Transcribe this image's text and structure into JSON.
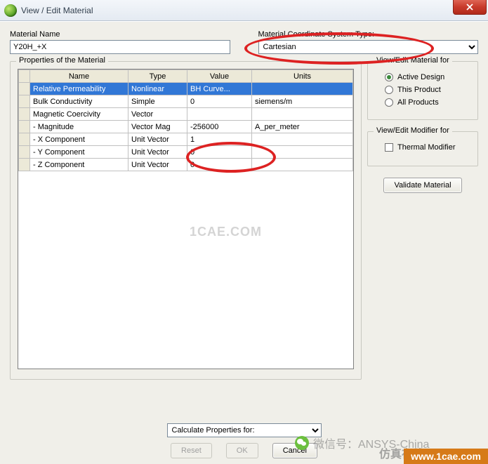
{
  "window": {
    "title": "View / Edit Material",
    "close": "Close"
  },
  "material_name": {
    "label": "Material Name",
    "value": "Y20H_+X"
  },
  "coord_system": {
    "label": "Material Coordinate System Type:",
    "selected": "Cartesian"
  },
  "properties": {
    "legend": "Properties of the Material",
    "headers": {
      "name": "Name",
      "type": "Type",
      "value": "Value",
      "units": "Units"
    },
    "rows": [
      {
        "name": "Relative Permeability",
        "type": "Nonlinear",
        "value": "BH Curve...",
        "units": "",
        "selected": true
      },
      {
        "name": "Bulk Conductivity",
        "type": "Simple",
        "value": "0",
        "units": "siemens/m"
      },
      {
        "name": "Magnetic Coercivity",
        "type": "Vector",
        "value": "",
        "units": ""
      },
      {
        "name": "- Magnitude",
        "type": "Vector Mag",
        "value": "-256000",
        "units": "A_per_meter"
      },
      {
        "name": "- X Component",
        "type": "Unit Vector",
        "value": "1",
        "units": ""
      },
      {
        "name": "- Y Component",
        "type": "Unit Vector",
        "value": "0",
        "units": ""
      },
      {
        "name": "- Z Component",
        "type": "Unit Vector",
        "value": "0",
        "units": ""
      }
    ]
  },
  "view_edit_for": {
    "legend": "View/Edit Material for",
    "options": {
      "active_design": "Active Design",
      "this_product": "This Product",
      "all_products": "All Products"
    },
    "selected": "active_design"
  },
  "modifier": {
    "legend": "View/Edit Modifier for",
    "thermal": "Thermal Modifier"
  },
  "buttons": {
    "validate": "Validate Material",
    "reset": "Reset",
    "ok": "OK",
    "cancel": "Cancel"
  },
  "calc": {
    "label": "Calculate Properties for:"
  },
  "watermarks": {
    "center": "1CAE.COM",
    "wechat_label": "微信号：ANSYS-China",
    "site_name": "仿真在线",
    "url": "www.1cae.com"
  }
}
